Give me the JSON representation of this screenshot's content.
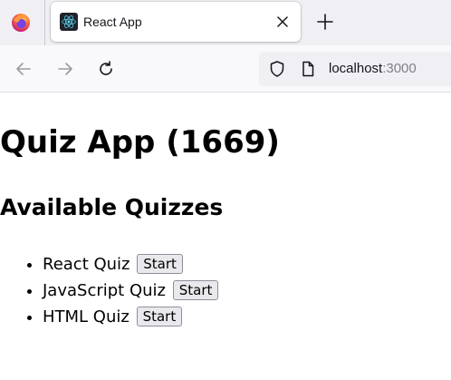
{
  "browser": {
    "brand_icon": "firefox-icon",
    "tab": {
      "title": "React App",
      "favicon": "react-icon",
      "close_icon": "close-icon"
    },
    "new_tab_icon": "plus-icon",
    "nav": {
      "back_icon": "arrow-left-icon",
      "forward_icon": "arrow-right-icon",
      "reload_icon": "reload-icon"
    },
    "url": {
      "host": "localhost",
      "port": ":3000",
      "shield_icon": "shield-icon",
      "page_icon": "page-icon"
    }
  },
  "app": {
    "title": "Quiz App (1669)",
    "subtitle": "Available Quizzes",
    "start_label": "Start",
    "quizzes": [
      {
        "name": "React Quiz"
      },
      {
        "name": "JavaScript Quiz"
      },
      {
        "name": "HTML Quiz"
      }
    ]
  },
  "colors": {
    "accent_firefox": "#ff7139",
    "react_blue": "#61dafb",
    "tabbar_bg": "#f0f0f4",
    "navbar_bg": "#f9f9fb"
  }
}
